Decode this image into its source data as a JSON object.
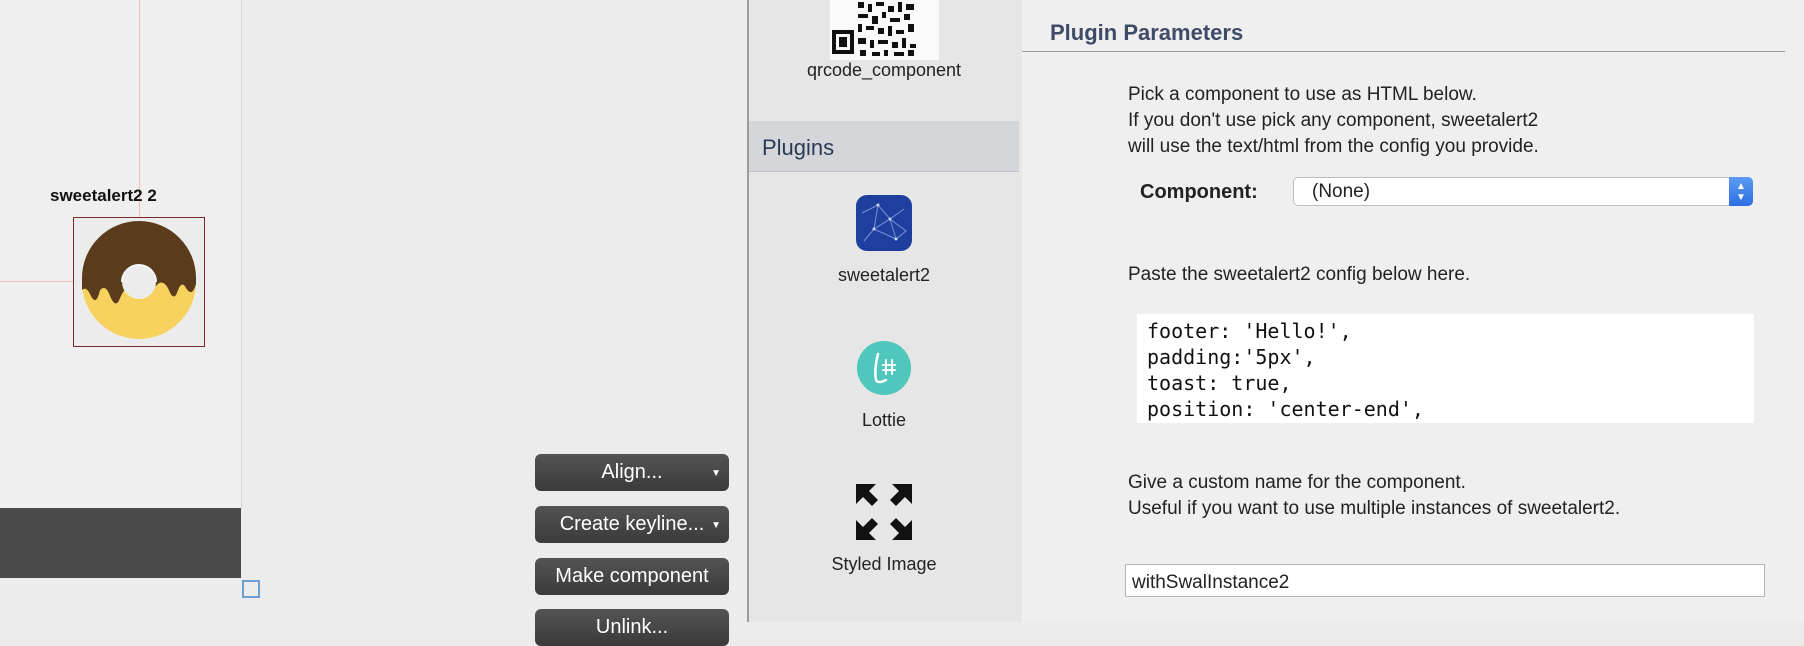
{
  "canvas": {
    "component_label": "sweetalert2 2"
  },
  "toolbar": {
    "align_label": "Align...",
    "keyline_label": "Create keyline...",
    "make_component_label": "Make component",
    "unlink_label": "Unlink..."
  },
  "plugins_column": {
    "top_item_label": "qrcode_component",
    "header": "Plugins",
    "items": [
      {
        "label": "sweetalert2",
        "icon": "sweetalert2-icon",
        "color": "#1f3f9e"
      },
      {
        "label": "Lottie",
        "icon": "lottie-icon",
        "color": "#4fc7bd"
      },
      {
        "label": "Styled Image",
        "icon": "expand-arrows-icon",
        "color": "#111111"
      }
    ]
  },
  "plugin_parameters": {
    "title": "Plugin Parameters",
    "intro_lines": [
      "Pick a component to use as HTML below.",
      "If you don't use pick any component, sweetalert2",
      "will use the text/html from the config you provide."
    ],
    "component_label": "Component:",
    "component_value": "(None)",
    "config_label": "Paste the sweetalert2 config below here.",
    "config_lines": [
      "footer: 'Hello!',",
      "padding:'5px',",
      "toast: true,",
      "position: 'center-end',"
    ],
    "name_lines": [
      "Give a custom name for the component.",
      "Useful if you want to use multiple instances of sweetalert2."
    ],
    "name_value": "withSwalInstance2"
  },
  "colors": {
    "accent_blue": "#2c6fe2",
    "title": "#3e4a66",
    "dark_button": "#3a3a3a"
  }
}
